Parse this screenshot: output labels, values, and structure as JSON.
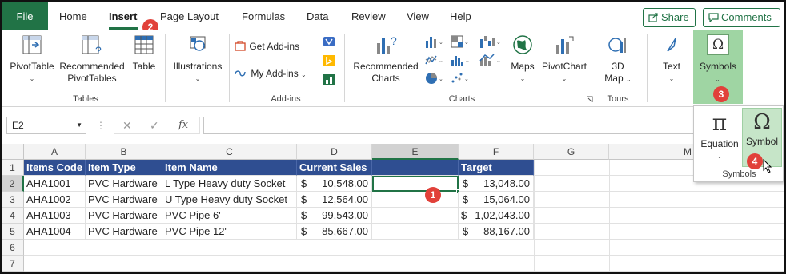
{
  "tabs": {
    "file": "File",
    "home": "Home",
    "insert": "Insert",
    "page_layout": "Page Layout",
    "formulas": "Formulas",
    "data": "Data",
    "review": "Review",
    "view": "View",
    "help": "Help"
  },
  "header_buttons": {
    "share": "Share",
    "comments": "Comments"
  },
  "ribbon": {
    "pivottable": "PivotTable",
    "rec_pivot_1": "Recommended",
    "rec_pivot_2": "PivotTables",
    "table": "Table",
    "tables_group": "Tables",
    "illustrations": "Illustrations",
    "get_addins": "Get Add-ins",
    "my_addins": "My Add-ins",
    "addins_group": "Add-ins",
    "rec_charts_1": "Recommended",
    "rec_charts_2": "Charts",
    "maps": "Maps",
    "pivotchart": "PivotChart",
    "charts_group": "Charts",
    "map3d_1": "3D",
    "map3d_2": "Map",
    "tours_group": "Tours",
    "text": "Text",
    "symbols": "Symbols"
  },
  "symbols_menu": {
    "equation": "Equation",
    "symbol": "Symbol",
    "group": "Symbols"
  },
  "formula_bar": {
    "name_box": "E2",
    "fx": "fx",
    "formula": ""
  },
  "columns": [
    "A",
    "B",
    "C",
    "D",
    "E",
    "F",
    "G",
    "M"
  ],
  "rows": [
    "1",
    "2",
    "3",
    "4",
    "5",
    "6",
    "7"
  ],
  "table": {
    "headers": [
      "Items Code",
      "Item Type",
      "Item Name",
      "Current Sales",
      "Target"
    ],
    "currency": "$",
    "rows": [
      {
        "code": "AHA1001",
        "type": "PVC Hardware",
        "name": "L Type Heavy duty Socket",
        "sales": "10,548.00",
        "target": "13,048.00"
      },
      {
        "code": "AHA1002",
        "type": "PVC Hardware",
        "name": "U Type Heavy duty Socket",
        "sales": "12,564.00",
        "target": "15,064.00"
      },
      {
        "code": "AHA1003",
        "type": "PVC Hardware",
        "name": "PVC Pipe 6'",
        "sales": "99,543.00",
        "target": "1,02,043.00"
      },
      {
        "code": "AHA1004",
        "type": "PVC Hardware",
        "name": "PVC Pipe 12'",
        "sales": "85,667.00",
        "target": "88,167.00"
      }
    ]
  },
  "callouts": [
    "1",
    "2",
    "3",
    "4"
  ],
  "colors": {
    "excel_green": "#217346",
    "header_blue": "#2f4e91",
    "badge_red": "#e1413a"
  }
}
